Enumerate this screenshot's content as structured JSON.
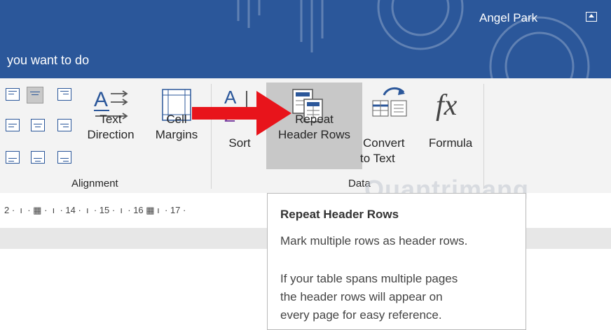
{
  "header": {
    "user_name": "Angel Park",
    "tell_me": "you want to do"
  },
  "ribbon": {
    "text_direction": [
      "Text",
      "Direction"
    ],
    "cell_margins": [
      "Cell",
      "Margins"
    ],
    "sort": "Sort",
    "repeat_header_rows": [
      "Repeat",
      "Header Rows"
    ],
    "convert_to_text": [
      "Convert",
      "to Text"
    ],
    "formula": "Formula",
    "alignment_group": "Alignment",
    "data_group": "Data"
  },
  "ruler": "2 ·  ı  · ▦ ·  ı  · 14 ·  ı  · 15 ·  ı  · 16 ▦ ı  · 17 ·",
  "tooltip": {
    "title": "Repeat Header Rows",
    "lines": [
      "Mark multiple rows as header rows.",
      "If your table spans multiple pages",
      "the header rows will appear on",
      "every page for easy reference."
    ]
  },
  "watermark": "Quantrimang",
  "colors": {
    "title_bar": "#2b579a",
    "arrow": "#e8141b",
    "selection": "#c8c8c8"
  }
}
